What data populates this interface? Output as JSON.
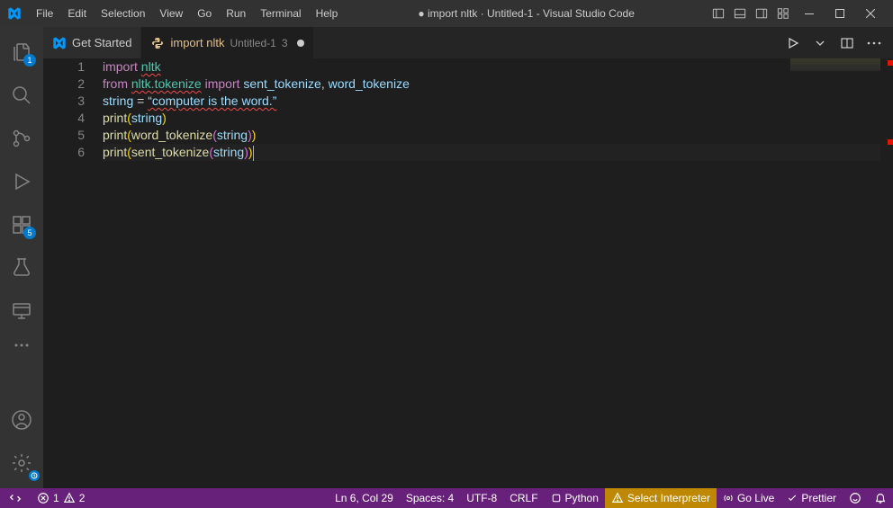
{
  "titlebar": {
    "title": "● import nltk · Untitled-1 - Visual Studio Code",
    "menu": [
      "File",
      "Edit",
      "Selection",
      "View",
      "Go",
      "Run",
      "Terminal",
      "Help"
    ]
  },
  "activityBar": {
    "explorerBadge": "1",
    "extensionsBadge": "5"
  },
  "tabs": {
    "getStarted": "Get Started",
    "activeTab": {
      "label": "import nltk",
      "suffix": "Untitled-1",
      "counter": "3"
    }
  },
  "code": {
    "lineNumbers": [
      "1",
      "2",
      "3",
      "4",
      "5",
      "6"
    ],
    "lines": {
      "l1": {
        "import": "import",
        "nltk": "nltk"
      },
      "l2": {
        "from": "from",
        "mod": "nltk.tokenize",
        "import": "import",
        "sent": "sent_tokenize",
        "word": "word_tokenize"
      },
      "l3": {
        "string": "string",
        "eq": "=",
        "val": "“computer is the word.”"
      },
      "l4": {
        "print": "print",
        "arg": "string"
      },
      "l5": {
        "print": "print",
        "fn": "word_tokenize",
        "arg": "string"
      },
      "l6": {
        "print": "print",
        "fn": "sent_tokenize",
        "arg": "string"
      }
    }
  },
  "statusBar": {
    "errors": "1",
    "warnings": "2",
    "cursor": "Ln 6, Col 29",
    "spaces": "Spaces: 4",
    "encoding": "UTF-8",
    "eol": "CRLF",
    "lang": "Python",
    "interpreter": "Select Interpreter",
    "goLive": "Go Live",
    "prettier": "Prettier"
  }
}
